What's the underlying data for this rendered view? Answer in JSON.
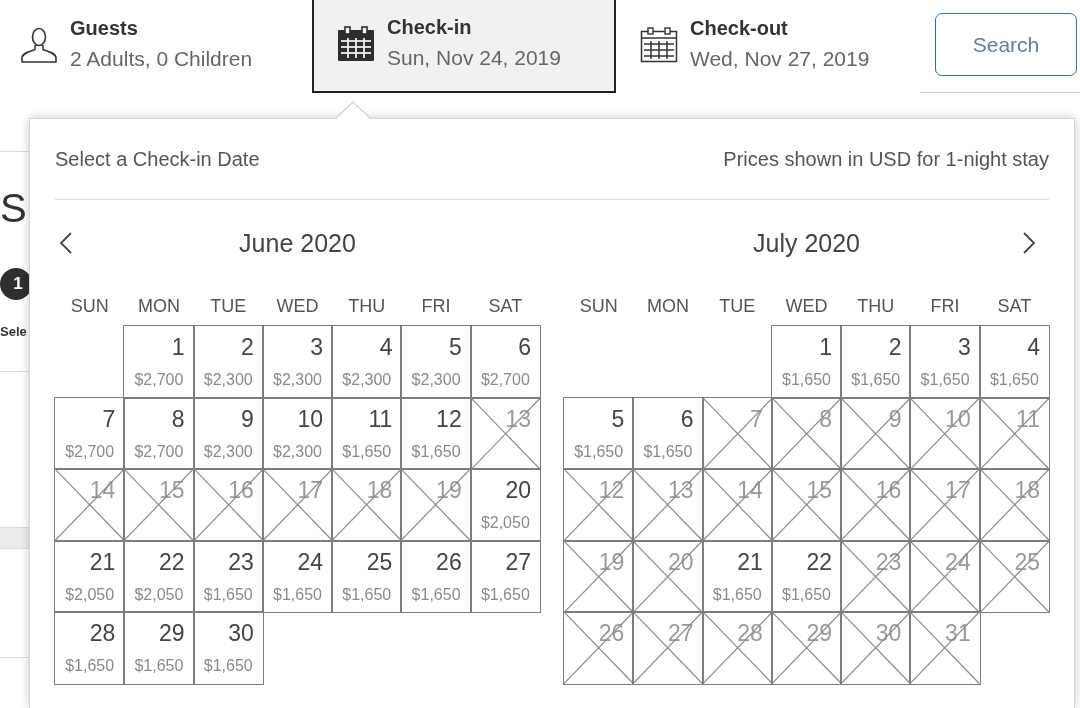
{
  "background_page": {
    "heading": "S",
    "step_badge": "1",
    "step_label": "Sele"
  },
  "search_bar": {
    "fields": [
      {
        "kind": "guests",
        "label": "Guests",
        "value": "2 Adults, 0 Children",
        "selected": false
      },
      {
        "kind": "date",
        "label": "Check-in",
        "value": "Sun, Nov 24, 2019",
        "selected": true
      },
      {
        "kind": "date",
        "label": "Check-out",
        "value": "Wed, Nov 27, 2019",
        "selected": false
      }
    ],
    "search_button": "Search"
  },
  "date_picker": {
    "title": "Select a Check-in Date",
    "note": "Prices shown in USD for 1-night stay",
    "months": [
      {
        "title": "June 2020",
        "weekdays": [
          "SUN",
          "MON",
          "TUE",
          "WED",
          "THU",
          "FRI",
          "SAT"
        ],
        "weeks": [
          [
            {
              "day": "1",
              "price": "$2,700",
              "available": true
            },
            {
              "day": "2",
              "price": "$2,300",
              "available": true
            },
            {
              "day": "3",
              "price": "$2,300",
              "available": true
            },
            {
              "day": "4",
              "price": "$2,300",
              "available": true
            },
            {
              "day": "5",
              "price": "$2,300",
              "available": true
            },
            {
              "day": "6",
              "price": "$2,700",
              "available": true
            }
          ],
          [
            {
              "day": "7",
              "price": "$2,700",
              "available": true
            },
            {
              "day": "8",
              "price": "$2,700",
              "available": true
            },
            {
              "day": "9",
              "price": "$2,300",
              "available": true
            },
            {
              "day": "10",
              "price": "$2,300",
              "available": true
            },
            {
              "day": "11",
              "price": "$1,650",
              "available": true
            },
            {
              "day": "12",
              "price": "$1,650",
              "available": true
            },
            {
              "day": "13",
              "available": false
            }
          ],
          [
            {
              "day": "14",
              "available": false
            },
            {
              "day": "15",
              "available": false
            },
            {
              "day": "16",
              "available": false
            },
            {
              "day": "17",
              "available": false
            },
            {
              "day": "18",
              "available": false
            },
            {
              "day": "19",
              "available": false
            },
            {
              "day": "20",
              "price": "$2,050",
              "available": true
            }
          ],
          [
            {
              "day": "21",
              "price": "$2,050",
              "available": true
            },
            {
              "day": "22",
              "price": "$2,050",
              "available": true
            },
            {
              "day": "23",
              "price": "$1,650",
              "available": true
            },
            {
              "day": "24",
              "price": "$1,650",
              "available": true
            },
            {
              "day": "25",
              "price": "$1,650",
              "available": true
            },
            {
              "day": "26",
              "price": "$1,650",
              "available": true
            },
            {
              "day": "27",
              "price": "$1,650",
              "available": true
            }
          ],
          [
            {
              "day": "28",
              "price": "$1,650",
              "available": true
            },
            {
              "day": "29",
              "price": "$1,650",
              "available": true
            },
            {
              "day": "30",
              "price": "$1,650",
              "available": true
            }
          ]
        ]
      },
      {
        "title": "July 2020",
        "weekdays": [
          "SUN",
          "MON",
          "TUE",
          "WED",
          "THU",
          "FRI",
          "SAT"
        ],
        "weeks": [
          [
            {
              "day": "1",
              "price": "$1,650",
              "available": true
            },
            {
              "day": "2",
              "price": "$1,650",
              "available": true
            },
            {
              "day": "3",
              "price": "$1,650",
              "available": true
            },
            {
              "day": "4",
              "price": "$1,650",
              "available": true
            }
          ],
          [
            {
              "day": "5",
              "price": "$1,650",
              "available": true
            },
            {
              "day": "6",
              "price": "$1,650",
              "available": true
            },
            {
              "day": "7",
              "available": false
            },
            {
              "day": "8",
              "available": false
            },
            {
              "day": "9",
              "available": false
            },
            {
              "day": "10",
              "available": false
            },
            {
              "day": "11",
              "available": false
            }
          ],
          [
            {
              "day": "12",
              "available": false
            },
            {
              "day": "13",
              "available": false
            },
            {
              "day": "14",
              "available": false
            },
            {
              "day": "15",
              "available": false
            },
            {
              "day": "16",
              "available": false
            },
            {
              "day": "17",
              "available": false
            },
            {
              "day": "18",
              "available": false
            }
          ],
          [
            {
              "day": "19",
              "available": false
            },
            {
              "day": "20",
              "available": false
            },
            {
              "day": "21",
              "price": "$1,650",
              "available": true
            },
            {
              "day": "22",
              "price": "$1,650",
              "available": true
            },
            {
              "day": "23",
              "available": false
            },
            {
              "day": "24",
              "available": false
            },
            {
              "day": "25",
              "available": false
            }
          ],
          [
            {
              "day": "26",
              "available": false
            },
            {
              "day": "27",
              "available": false
            },
            {
              "day": "28",
              "available": false
            },
            {
              "day": "29",
              "available": false
            },
            {
              "day": "30",
              "available": false
            },
            {
              "day": "31",
              "available": false
            }
          ]
        ]
      }
    ]
  }
}
